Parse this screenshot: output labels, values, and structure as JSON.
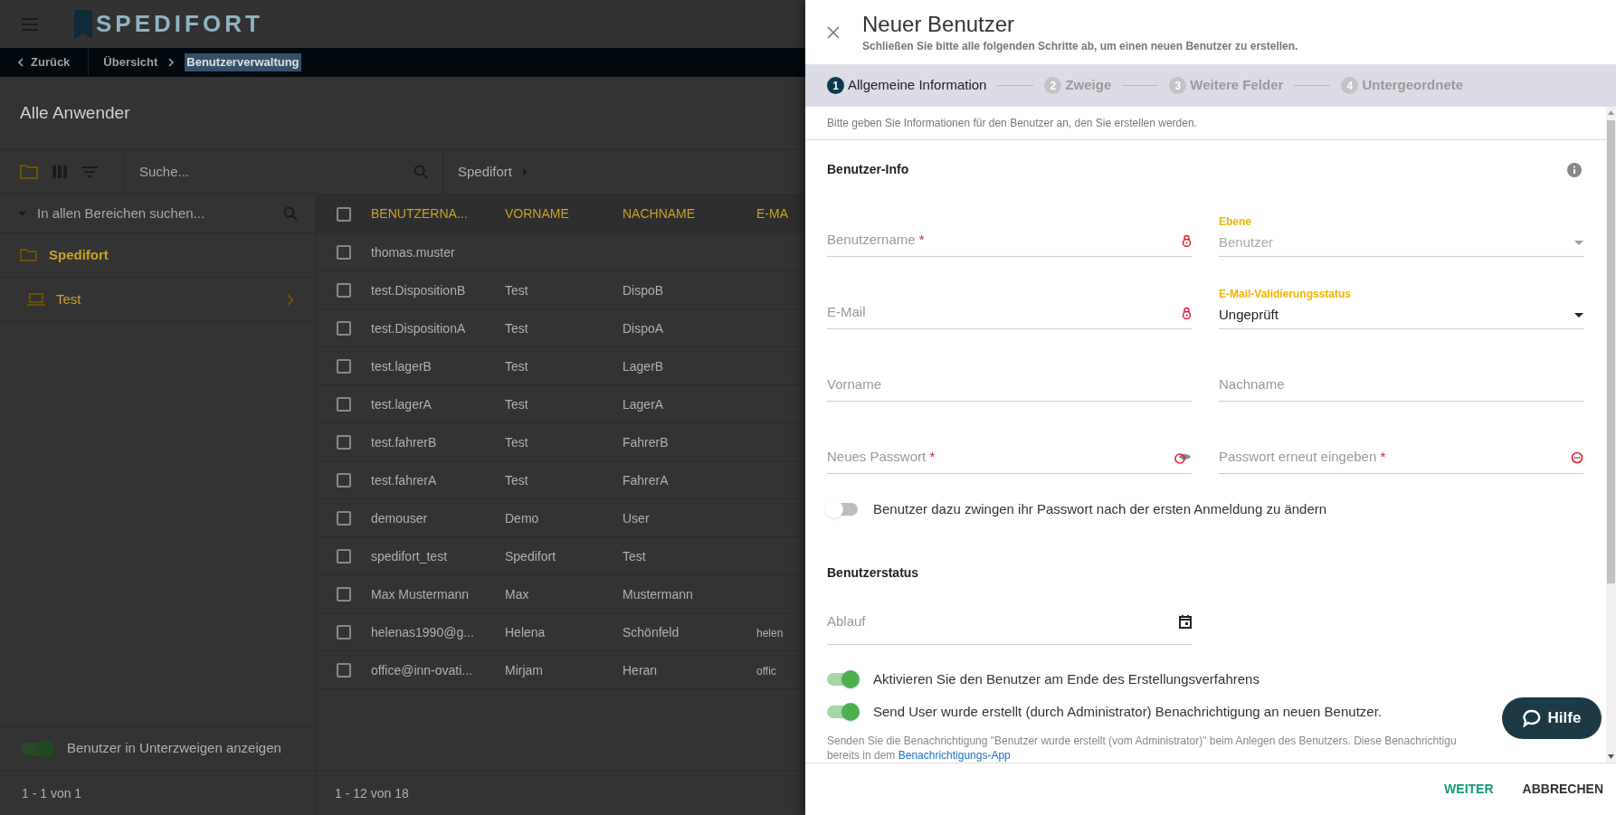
{
  "app": {
    "logo": "SPEDIFORT",
    "back": "Zurück",
    "breadcrumb": [
      {
        "label": "Übersicht",
        "selected": false
      },
      {
        "label": "Benutzerverwaltung",
        "selected": true
      }
    ],
    "page_title": "Alle Anwender",
    "toolbar": {
      "search_placeholder": "Suche...",
      "path": "Spedifort"
    },
    "tree": {
      "search_placeholder": "In allen Bereichen suchen...",
      "items": [
        {
          "label": "Spedifort",
          "kind": "folder",
          "children": [
            {
              "label": "Test",
              "kind": "device"
            }
          ]
        }
      ]
    },
    "subbranch_toggle": {
      "label": "Benutzer in Unterzweigen anzeigen",
      "on": true
    },
    "tree_pagination": "1 - 1 von 1",
    "table": {
      "header_checked": false,
      "columns": [
        "BENUTZERNA...",
        "VORNAME",
        "NACHNAME",
        "E-MA"
      ],
      "rows": [
        {
          "checked": false,
          "cells": [
            "thomas.muster",
            "",
            "",
            ""
          ]
        },
        {
          "checked": false,
          "cells": [
            "test.DispositionB",
            "Test",
            "DispoB",
            ""
          ]
        },
        {
          "checked": false,
          "cells": [
            "test.DispositionA",
            "Test",
            "DispoA",
            ""
          ]
        },
        {
          "checked": false,
          "cells": [
            "test.lagerB",
            "Test",
            "LagerB",
            ""
          ]
        },
        {
          "checked": false,
          "cells": [
            "test.lagerA",
            "Test",
            "LagerA",
            ""
          ]
        },
        {
          "checked": false,
          "cells": [
            "test.fahrerB",
            "Test",
            "FahrerB",
            ""
          ]
        },
        {
          "checked": false,
          "cells": [
            "test.fahrerA",
            "Test",
            "FahrerA",
            ""
          ]
        },
        {
          "checked": false,
          "cells": [
            "demouser",
            "Demo",
            "User",
            ""
          ]
        },
        {
          "checked": false,
          "cells": [
            "spedifort_test",
            "Spedifort",
            "Test",
            ""
          ]
        },
        {
          "checked": false,
          "cells": [
            "Max Mustermann",
            "Max",
            "Mustermann",
            ""
          ]
        },
        {
          "checked": false,
          "cells": [
            "helenas1990@g...",
            "Helena",
            "Schönfeld",
            "helen"
          ]
        },
        {
          "checked": false,
          "cells": [
            "office@inn-ovati...",
            "Mirjam",
            "Heran",
            "offic"
          ]
        }
      ],
      "pagination": "1 - 12 von 18"
    }
  },
  "dialog": {
    "title": "Neuer Benutzer",
    "subtitle": "Schließen Sie bitte alle folgenden Schritte ab, um einen neuen Benutzer zu erstellen.",
    "steps": [
      {
        "number": "1",
        "label": "Allgemeine Information",
        "selected": true
      },
      {
        "number": "2",
        "label": "Zweige",
        "selected": false
      },
      {
        "number": "3",
        "label": "Weitere Felder",
        "selected": false
      },
      {
        "number": "4",
        "label": "Untergeordnete",
        "selected": false
      }
    ],
    "intro": "Bitte geben Sie Informationen für den Benutzer an, den Sie erstellen werden.",
    "section_1": "Benutzer-Info",
    "field_rows": [
      {
        "fields": [
          {
            "kind": "locked",
            "label": "Benutzername",
            "required_mark": "*"
          },
          {
            "kind": "select",
            "label": "Ebene",
            "value": "Benutzer",
            "disabled": true
          }
        ]
      },
      {
        "fields": [
          {
            "kind": "locked",
            "label": "E-Mail"
          },
          {
            "kind": "select",
            "label": "E-Mail-Validierungsstatus",
            "value": "Ungeprüft",
            "disabled": false
          }
        ]
      },
      {
        "fields": [
          {
            "kind": "text",
            "label": "Vorname"
          },
          {
            "kind": "text",
            "label": "Nachname"
          }
        ]
      },
      {
        "fields": [
          {
            "kind": "password",
            "label": "Neues Passwort",
            "required_mark": "*"
          },
          {
            "kind": "confirm",
            "label": "Passwort erneut eingeben",
            "required_mark": "*"
          }
        ]
      }
    ],
    "force_change": {
      "label": "Benutzer dazu zwingen ihr Passwort nach der ersten Anmeldung zu ändern",
      "on": false
    },
    "section_2": "Benutzerstatus",
    "expiry": {
      "label": "Ablauf"
    },
    "toggles": [
      {
        "label": "Aktivieren Sie den Benutzer am Ende des Erstellungsverfahrens",
        "on": true
      },
      {
        "label": "Send User wurde erstellt (durch Administrator) Benachrichtigung an neuen Benutzer.",
        "on": true
      }
    ],
    "notice": {
      "line_1": "Senden Sie die Benachrichtigung \"Benutzer wurde erstellt (vom Administrator)\" beim Anlegen des Benutzers. Diese Benachrichtigu",
      "line_2": "bereits in dem",
      "link": "Benachrichtigungs-App"
    },
    "help": "Hilfe",
    "buttons": [
      {
        "label": "WEITER",
        "kind": "primary"
      },
      {
        "label": "ABBRECHEN",
        "kind": "secondary"
      }
    ]
  }
}
